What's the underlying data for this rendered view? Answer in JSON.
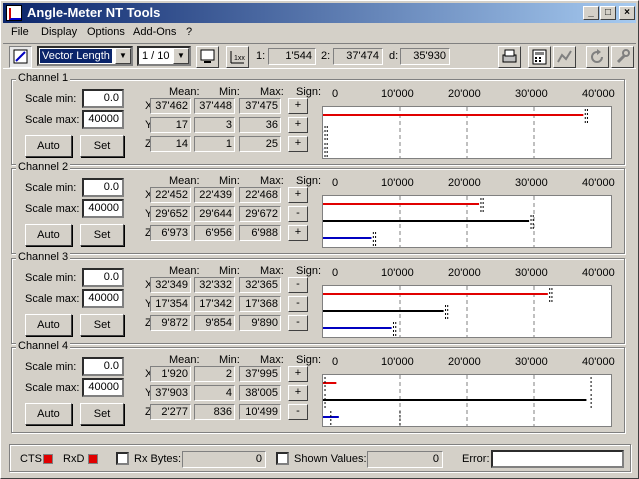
{
  "title": "Angle-Meter NT Tools",
  "menu": [
    "File",
    "Display",
    "Options",
    "Add-Ons",
    "?"
  ],
  "toolbar": {
    "mode": "Vector Length",
    "ratio": "1 / 10",
    "r1_label": "1:",
    "r1_value": "1'544",
    "r2_label": "2:",
    "r2_value": "37'474",
    "rd_label": "d:",
    "rd_value": "35'930"
  },
  "labels": {
    "scale_min": "Scale min:",
    "scale_max": "Scale max:",
    "mean": "Mean:",
    "min": "Min:",
    "max": "Max:",
    "sign": "Sign:",
    "x": "X:",
    "y": "Y:",
    "z": "Z:",
    "auto": "Auto",
    "set": "Set",
    "ticks": [
      "0",
      "10'000",
      "20'000",
      "30'000",
      "40'000"
    ]
  },
  "axis_max": 40000,
  "colors": {
    "x": "#e00000",
    "y": "#000000",
    "z": "#0000c0"
  },
  "channels": [
    {
      "title": "Channel 1",
      "scale_min": "0.0",
      "scale_max": "40000",
      "rows": [
        {
          "mean": "37'462",
          "min": "37'448",
          "max": "37'475",
          "sign": "+",
          "v": 37462,
          "vmin": 37448,
          "vmax": 37475
        },
        {
          "mean": "17",
          "min": "3",
          "max": "36",
          "sign": "+",
          "v": 17,
          "vmin": 3,
          "vmax": 36
        },
        {
          "mean": "14",
          "min": "1",
          "max": "25",
          "sign": "+",
          "v": 14,
          "vmin": 1,
          "vmax": 25
        }
      ]
    },
    {
      "title": "Channel 2",
      "scale_min": "0.0",
      "scale_max": "40000",
      "rows": [
        {
          "mean": "22'452",
          "min": "22'439",
          "max": "22'468",
          "sign": "+",
          "v": 22452,
          "vmin": 22439,
          "vmax": 22468
        },
        {
          "mean": "29'652",
          "min": "29'644",
          "max": "29'672",
          "sign": "-",
          "v": 29652,
          "vmin": 29644,
          "vmax": 29672
        },
        {
          "mean": "6'973",
          "min": "6'956",
          "max": "6'988",
          "sign": "+",
          "v": 6973,
          "vmin": 6956,
          "vmax": 6988
        }
      ]
    },
    {
      "title": "Channel 3",
      "scale_min": "0.0",
      "scale_max": "40000",
      "rows": [
        {
          "mean": "32'349",
          "min": "32'332",
          "max": "32'365",
          "sign": "-",
          "v": 32349,
          "vmin": 32332,
          "vmax": 32365
        },
        {
          "mean": "17'354",
          "min": "17'342",
          "max": "17'368",
          "sign": "-",
          "v": 17354,
          "vmin": 17342,
          "vmax": 17368
        },
        {
          "mean": "9'872",
          "min": "9'854",
          "max": "9'890",
          "sign": "-",
          "v": 9872,
          "vmin": 9854,
          "vmax": 9890
        }
      ]
    },
    {
      "title": "Channel 4",
      "scale_min": "0.0",
      "scale_max": "40000",
      "rows": [
        {
          "mean": "1'920",
          "min": "2",
          "max": "37'995",
          "sign": "+",
          "v": 1920,
          "vmin": 2,
          "vmax": 37995
        },
        {
          "mean": "37'903",
          "min": "4",
          "max": "38'005",
          "sign": "+",
          "v": 37903,
          "vmin": 4,
          "vmax": 38005
        },
        {
          "mean": "2'277",
          "min": "836",
          "max": "10'499",
          "sign": "-",
          "v": 2277,
          "vmin": 836,
          "vmax": 10499
        }
      ]
    }
  ],
  "status": {
    "cts": "CTS",
    "rxd": "RxD",
    "rx_bytes_label": "Rx Bytes:",
    "rx_bytes": "0",
    "shown_label": "Shown Values:",
    "shown": "0",
    "error_label": "Error:",
    "error": ""
  }
}
